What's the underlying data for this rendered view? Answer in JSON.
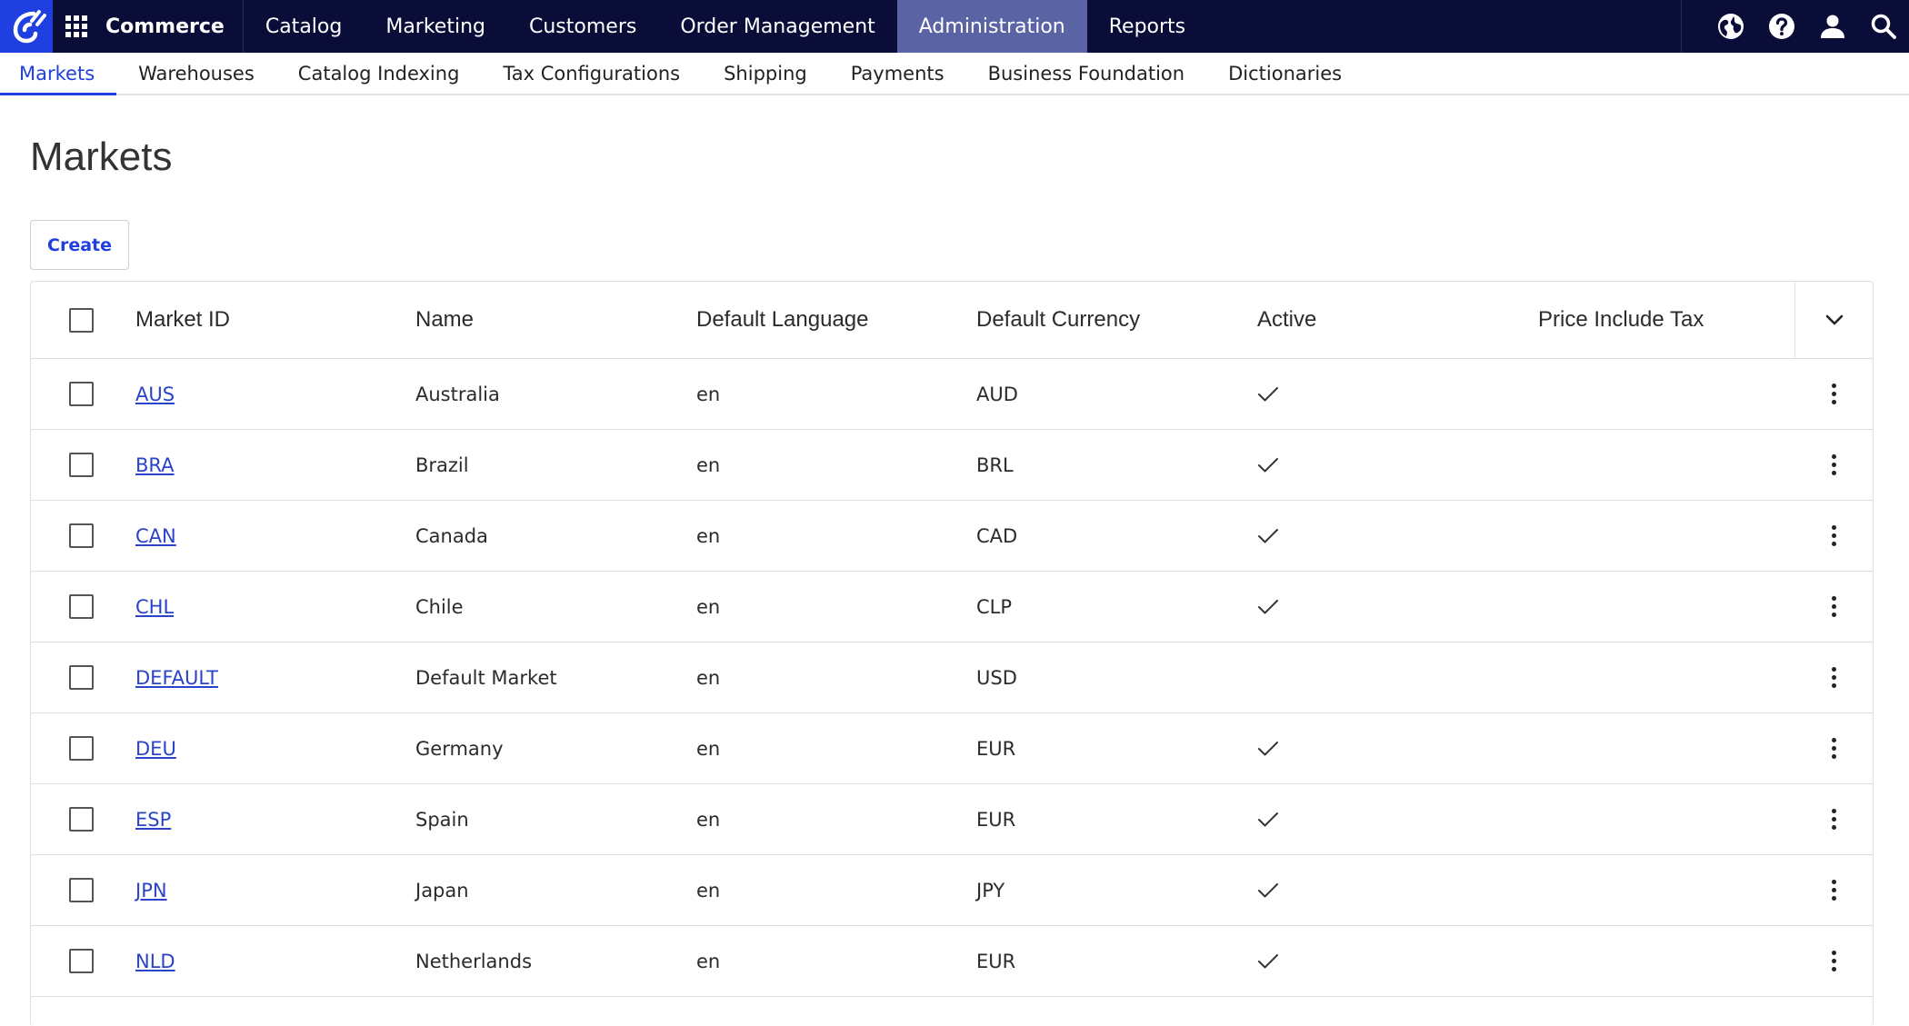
{
  "topbar": {
    "product": "Commerce",
    "nav": [
      "Catalog",
      "Marketing",
      "Customers",
      "Order Management",
      "Administration",
      "Reports"
    ],
    "active_nav": "Administration",
    "icons": [
      "globe-icon",
      "help-icon",
      "user-icon",
      "search-icon"
    ]
  },
  "subnav": {
    "items": [
      "Markets",
      "Warehouses",
      "Catalog Indexing",
      "Tax Configurations",
      "Shipping",
      "Payments",
      "Business Foundation",
      "Dictionaries"
    ],
    "active": "Markets"
  },
  "page": {
    "title": "Markets",
    "create_label": "Create"
  },
  "grid": {
    "columns": [
      "Market ID",
      "Name",
      "Default Language",
      "Default Currency",
      "Active",
      "Price Include Tax"
    ],
    "rows": [
      {
        "id": "AUS",
        "name": "Australia",
        "language": "en",
        "currency": "AUD",
        "active": true,
        "price_include_tax": false
      },
      {
        "id": "BRA",
        "name": "Brazil",
        "language": "en",
        "currency": "BRL",
        "active": true,
        "price_include_tax": false
      },
      {
        "id": "CAN",
        "name": "Canada",
        "language": "en",
        "currency": "CAD",
        "active": true,
        "price_include_tax": false
      },
      {
        "id": "CHL",
        "name": "Chile",
        "language": "en",
        "currency": "CLP",
        "active": true,
        "price_include_tax": false
      },
      {
        "id": "DEFAULT",
        "name": "Default Market",
        "language": "en",
        "currency": "USD",
        "active": false,
        "price_include_tax": false
      },
      {
        "id": "DEU",
        "name": "Germany",
        "language": "en",
        "currency": "EUR",
        "active": true,
        "price_include_tax": false
      },
      {
        "id": "ESP",
        "name": "Spain",
        "language": "en",
        "currency": "EUR",
        "active": true,
        "price_include_tax": false
      },
      {
        "id": "JPN",
        "name": "Japan",
        "language": "en",
        "currency": "JPY",
        "active": true,
        "price_include_tax": false
      },
      {
        "id": "NLD",
        "name": "Netherlands",
        "language": "en",
        "currency": "EUR",
        "active": true,
        "price_include_tax": false
      }
    ]
  },
  "colors": {
    "topbar_bg": "#0b0d39",
    "logo_bg": "#1f3fe0",
    "active_nav_bg": "#5a64a5",
    "accent": "#1f3fe0",
    "link": "#2a43c8"
  }
}
